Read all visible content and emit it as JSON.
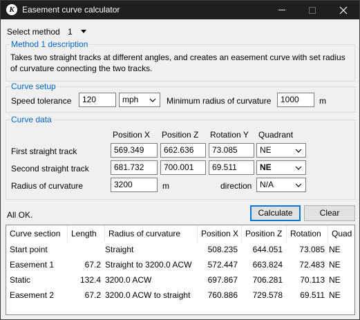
{
  "window": {
    "title": "Easement curve calculator"
  },
  "method": {
    "label": "Select method",
    "value": "1"
  },
  "method_group": {
    "title": "Method 1 description",
    "text_line1": "Takes two straight tracks at different angles, and creates an easement curve with set radius",
    "text_line2": "of curvature connecting the two tracks."
  },
  "curve_setup": {
    "title": "Curve setup",
    "speed_label": "Speed tolerance",
    "speed_value": "120",
    "unit_value": "mph",
    "min_radius_label": "Minimum radius of curvature",
    "min_radius_value": "1000",
    "min_radius_unit": "m"
  },
  "curve_data": {
    "title": "Curve data",
    "headers": [
      "Position X",
      "Position Z",
      "Rotation Y",
      "Quadrant"
    ],
    "first": {
      "label": "First straight track",
      "x": "569.349",
      "z": "662.636",
      "rot": "73.085",
      "quad": "NE"
    },
    "second": {
      "label": "Second straight track",
      "x": "681.732",
      "z": "700.001",
      "rot": "69.511",
      "quad": "NE"
    },
    "radius": {
      "label": "Radius of curvature",
      "value": "3200",
      "unit": "m",
      "direction_label": "direction",
      "direction_value": "N/A"
    }
  },
  "status": "All OK.",
  "buttons": {
    "calculate": "Calculate",
    "clear": "Clear"
  },
  "results": {
    "columns": [
      "Curve section",
      "Length",
      "Radius of curvature",
      "Position X",
      "Position Z",
      "Rotation",
      "Quad"
    ],
    "rows": [
      [
        "Start point",
        "",
        "Straight",
        "508.235",
        "644.051",
        "73.085",
        "NE"
      ],
      [
        "Easement 1",
        "67.2",
        "Straight to 3200.0 ACW",
        "572.447",
        "663.824",
        "72.483",
        "NE"
      ],
      [
        "Static",
        "132.4",
        "3200.0 ACW",
        "697.867",
        "706.281",
        "70.113",
        "NE"
      ],
      [
        "Easement 2",
        "67.2",
        "3200.0 ACW to straight",
        "760.886",
        "729.578",
        "69.511",
        "NE"
      ]
    ]
  }
}
